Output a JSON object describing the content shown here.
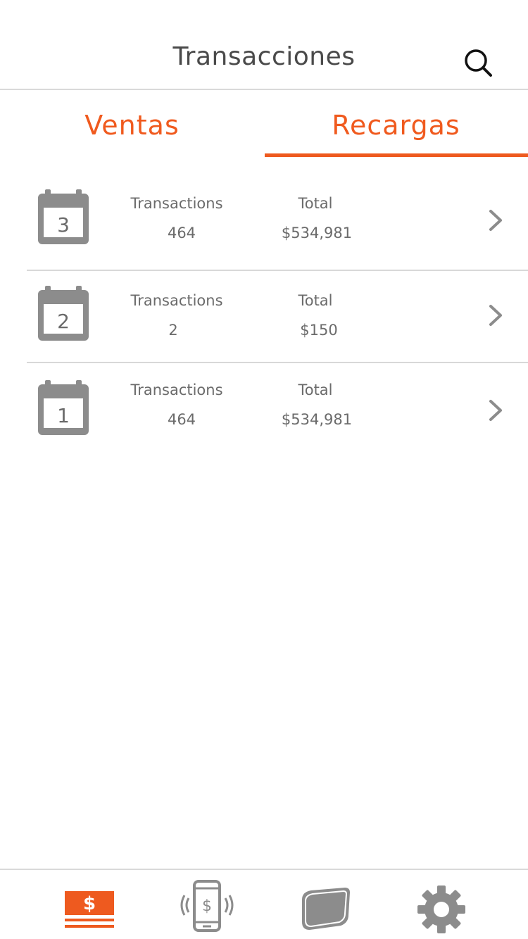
{
  "header": {
    "title": "Transacciones"
  },
  "tabs": [
    {
      "label": "Ventas",
      "selected": false
    },
    {
      "label": "Recargas",
      "selected": true
    }
  ],
  "rows": [
    {
      "day": "3",
      "transactions_label": "Transactions",
      "transactions": "464",
      "total_label": "Total",
      "total": "$534,981"
    },
    {
      "day": "2",
      "transactions_label": "Transactions",
      "transactions": "2",
      "total_label": "Total",
      "total": "$150"
    },
    {
      "day": "1",
      "transactions_label": "Transactions",
      "transactions": "464",
      "total_label": "Total",
      "total": "$534,981"
    }
  ],
  "bottom_nav": [
    {
      "icon": "sales-icon",
      "active": true
    },
    {
      "icon": "phone-payment-icon",
      "active": false
    },
    {
      "icon": "card-icon",
      "active": false
    },
    {
      "icon": "gear-icon",
      "active": false
    }
  ],
  "colors": {
    "accent": "#ee5a1f",
    "icon_gray": "#8c8c8c",
    "text": "#6b6b6b"
  }
}
